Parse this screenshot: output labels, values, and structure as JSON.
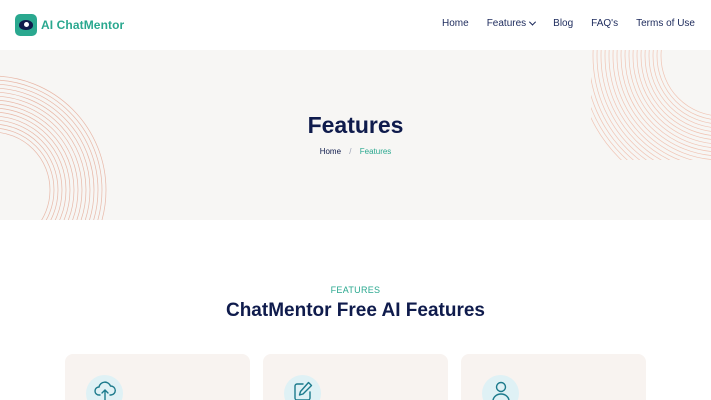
{
  "app": {
    "name": "AI ChatMentor",
    "brand_color": "#2aa88f",
    "text_color": "#0f1b4c"
  },
  "nav": {
    "items": [
      {
        "label": "Home"
      },
      {
        "label": "Features",
        "has_dropdown": true
      },
      {
        "label": "Blog"
      },
      {
        "label": "FAQ's"
      },
      {
        "label": "Terms of Use"
      }
    ]
  },
  "hero": {
    "title": "Features",
    "breadcrumb": {
      "home": "Home",
      "separator": "/",
      "current": "Features"
    }
  },
  "section": {
    "eyebrow": "FEATURES",
    "title": "ChatMentor Free AI Features",
    "cards": [
      {
        "icon": "cloud-upload-icon"
      },
      {
        "icon": "edit-icon"
      },
      {
        "icon": "user-icon"
      }
    ]
  }
}
